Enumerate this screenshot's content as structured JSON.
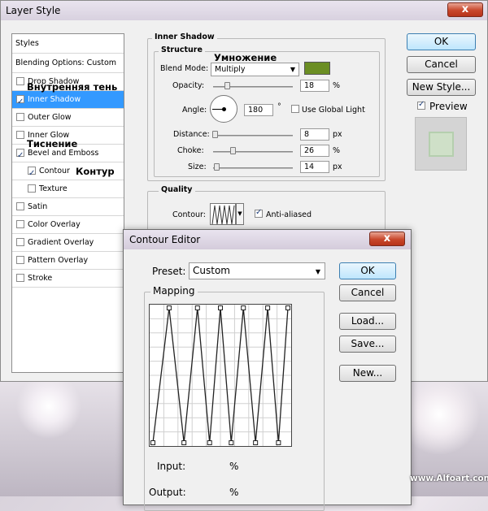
{
  "layer_style": {
    "title": "Layer Style",
    "close_label": "x",
    "styles_header": "Styles",
    "blending_options": "Blending Options: Custom",
    "items": [
      {
        "label": "Drop Shadow",
        "checked": false,
        "selected": false,
        "indent": false
      },
      {
        "label": "Inner Shadow",
        "checked": true,
        "selected": true,
        "indent": false
      },
      {
        "label": "Outer Glow",
        "checked": false,
        "selected": false,
        "indent": false
      },
      {
        "label": "Inner Glow",
        "checked": false,
        "selected": false,
        "indent": false
      },
      {
        "label": "Bevel and Emboss",
        "checked": true,
        "selected": false,
        "indent": false
      },
      {
        "label": "Contour",
        "checked": true,
        "selected": false,
        "indent": true
      },
      {
        "label": "Texture",
        "checked": false,
        "selected": false,
        "indent": true
      },
      {
        "label": "Satin",
        "checked": false,
        "selected": false,
        "indent": false
      },
      {
        "label": "Color Overlay",
        "checked": false,
        "selected": false,
        "indent": false
      },
      {
        "label": "Gradient Overlay",
        "checked": false,
        "selected": false,
        "indent": false
      },
      {
        "label": "Pattern Overlay",
        "checked": false,
        "selected": false,
        "indent": false
      },
      {
        "label": "Stroke",
        "checked": false,
        "selected": false,
        "indent": false
      }
    ],
    "annotations": {
      "inner_shadow_ru": "Внутренняя тень",
      "bevel_ru": "Тиснение",
      "contour_ru": "Контур",
      "multiply_ru": "Умножение"
    },
    "inner_shadow": {
      "section_title": "Inner Shadow",
      "structure_title": "Structure",
      "blend_mode_label": "Blend Mode:",
      "blend_mode_value": "Multiply",
      "shadow_color": "#6b8e23",
      "opacity_label": "Opacity:",
      "opacity_value": "18",
      "opacity_unit": "%",
      "angle_label": "Angle:",
      "angle_value": "180",
      "angle_unit": "°",
      "global_light_label": "Use Global Light",
      "global_light_checked": false,
      "distance_label": "Distance:",
      "distance_value": "8",
      "distance_unit": "px",
      "choke_label": "Choke:",
      "choke_value": "26",
      "choke_unit": "%",
      "size_label": "Size:",
      "size_value": "14",
      "size_unit": "px",
      "quality_title": "Quality",
      "contour_label": "Contour:",
      "anti_aliased_label": "Anti-aliased",
      "anti_aliased_checked": true
    },
    "buttons": {
      "ok": "OK",
      "cancel": "Cancel",
      "new_style": "New Style...",
      "preview_label": "Preview",
      "preview_checked": true
    }
  },
  "contour_editor": {
    "title": "Contour Editor",
    "close_label": "x",
    "preset_label": "Preset:",
    "preset_value": "Custom",
    "mapping_title": "Mapping",
    "input_label": "Input:",
    "input_unit": "%",
    "output_label": "Output:",
    "output_unit": "%",
    "buttons": {
      "ok": "OK",
      "cancel": "Cancel",
      "load": "Load...",
      "save": "Save...",
      "new": "New..."
    }
  },
  "watermark": "www.Alfoart.com"
}
